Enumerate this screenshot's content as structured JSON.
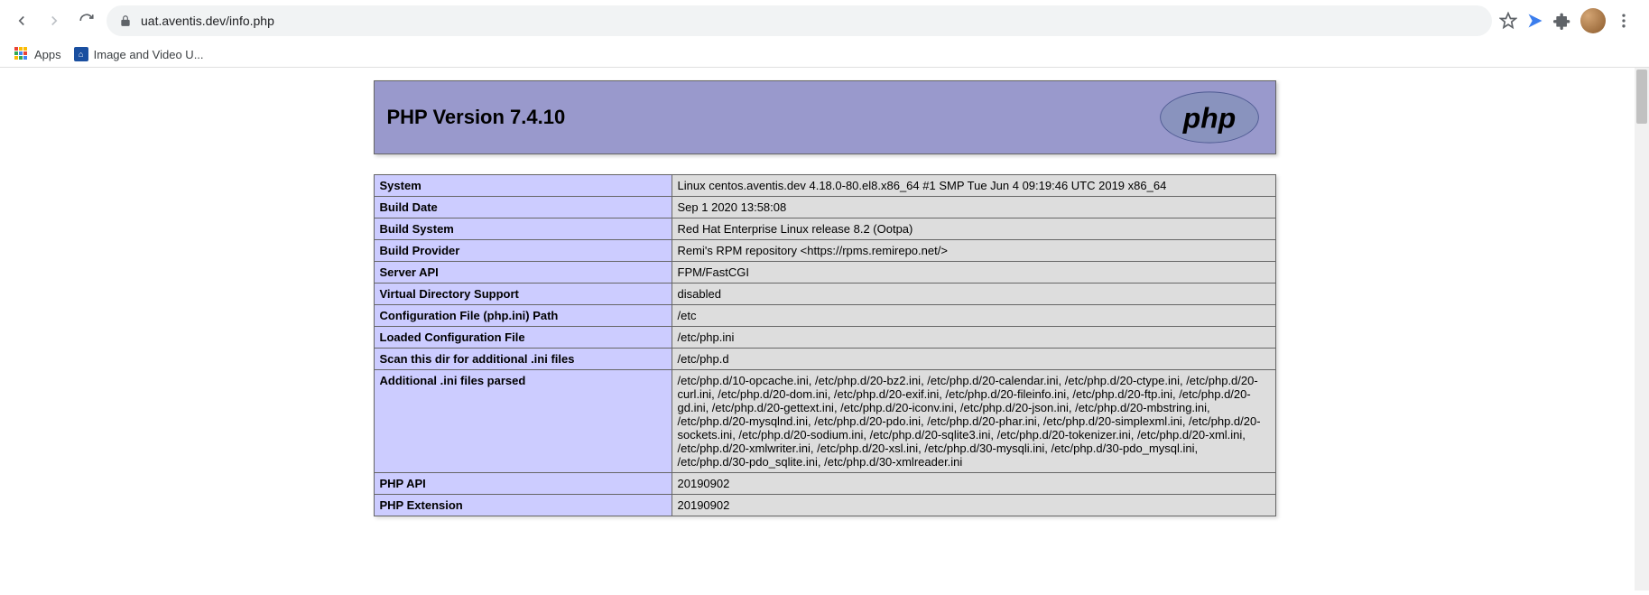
{
  "browser": {
    "url": "uat.aventis.dev/info.php",
    "bookmarks": {
      "apps_label": "Apps",
      "item1": "Image and Video U..."
    }
  },
  "header": {
    "title": "PHP Version 7.4.10"
  },
  "rows": [
    {
      "key": "System",
      "val": "Linux centos.aventis.dev 4.18.0-80.el8.x86_64 #1 SMP Tue Jun 4 09:19:46 UTC 2019 x86_64"
    },
    {
      "key": "Build Date",
      "val": "Sep 1 2020 13:58:08"
    },
    {
      "key": "Build System",
      "val": "Red Hat Enterprise Linux release 8.2 (Ootpa)"
    },
    {
      "key": "Build Provider",
      "val": "Remi's RPM repository <https://rpms.remirepo.net/>"
    },
    {
      "key": "Server API",
      "val": "FPM/FastCGI"
    },
    {
      "key": "Virtual Directory Support",
      "val": "disabled"
    },
    {
      "key": "Configuration File (php.ini) Path",
      "val": "/etc"
    },
    {
      "key": "Loaded Configuration File",
      "val": "/etc/php.ini"
    },
    {
      "key": "Scan this dir for additional .ini files",
      "val": "/etc/php.d"
    },
    {
      "key": "Additional .ini files parsed",
      "val": "/etc/php.d/10-opcache.ini, /etc/php.d/20-bz2.ini, /etc/php.d/20-calendar.ini, /etc/php.d/20-ctype.ini, /etc/php.d/20-curl.ini, /etc/php.d/20-dom.ini, /etc/php.d/20-exif.ini, /etc/php.d/20-fileinfo.ini, /etc/php.d/20-ftp.ini, /etc/php.d/20-gd.ini, /etc/php.d/20-gettext.ini, /etc/php.d/20-iconv.ini, /etc/php.d/20-json.ini, /etc/php.d/20-mbstring.ini, /etc/php.d/20-mysqlnd.ini, /etc/php.d/20-pdo.ini, /etc/php.d/20-phar.ini, /etc/php.d/20-simplexml.ini, /etc/php.d/20-sockets.ini, /etc/php.d/20-sodium.ini, /etc/php.d/20-sqlite3.ini, /etc/php.d/20-tokenizer.ini, /etc/php.d/20-xml.ini, /etc/php.d/20-xmlwriter.ini, /etc/php.d/20-xsl.ini, /etc/php.d/30-mysqli.ini, /etc/php.d/30-pdo_mysql.ini, /etc/php.d/30-pdo_sqlite.ini, /etc/php.d/30-xmlreader.ini"
    },
    {
      "key": "PHP API",
      "val": "20190902"
    },
    {
      "key": "PHP Extension",
      "val": "20190902"
    }
  ]
}
